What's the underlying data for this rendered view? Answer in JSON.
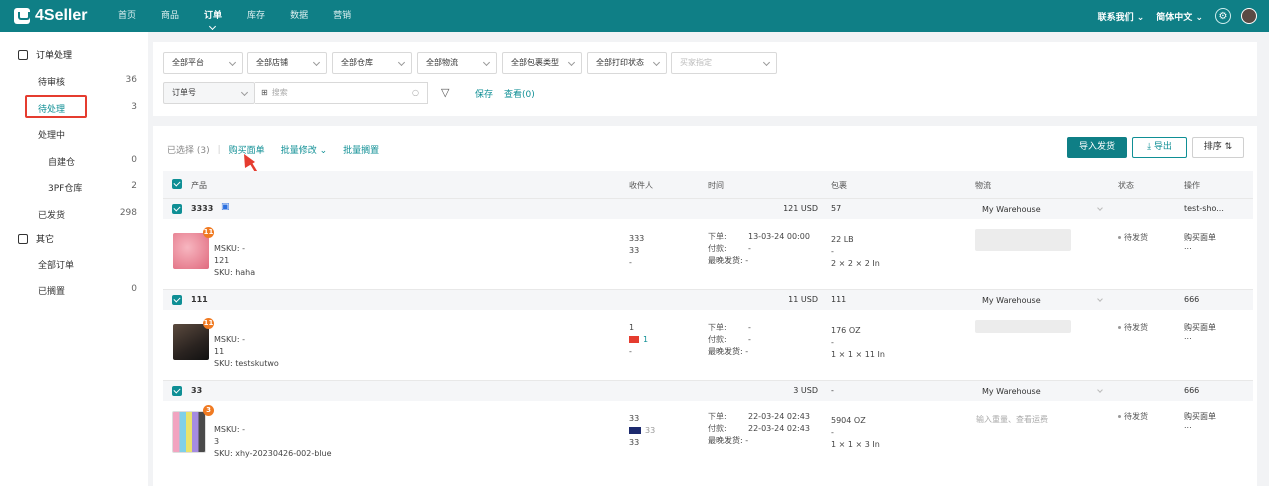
{
  "header": {
    "brand": "4Seller",
    "nav": [
      "首页",
      "商品",
      "订单",
      "库存",
      "数据",
      "营销"
    ],
    "active_nav": "订单",
    "contact": "联系我们",
    "language": "简体中文"
  },
  "sidebar": {
    "group1": "订单处理",
    "group2": "其它",
    "items": [
      {
        "label": "待审核",
        "count": "36"
      },
      {
        "label": "待处理",
        "count": "3"
      },
      {
        "label": "处理中",
        "count": ""
      },
      {
        "label": "自建仓",
        "count": "0"
      },
      {
        "label": "3PF仓库",
        "count": "2"
      },
      {
        "label": "已发货",
        "count": "298"
      },
      {
        "label": "全部订单",
        "count": ""
      },
      {
        "label": "已搁置",
        "count": "0"
      }
    ]
  },
  "filters": {
    "dropdowns": [
      "全部平台",
      "全部店铺",
      "全部仓库",
      "全部物流",
      "全部包裹类型",
      "全部打印状态",
      "买家指定"
    ],
    "order_no": "订单号",
    "search_placeholder": "搜索",
    "save": "保存",
    "view": "查看(0)"
  },
  "toolbar": {
    "selected": "已选择 (3)",
    "buy_label": "购买面单",
    "batch_edit": "批量修改",
    "batch_hold": "批量搁置",
    "import_ship": "导入发货",
    "export": "导出",
    "sort": "排序"
  },
  "table": {
    "headers": [
      "产品",
      "收件人",
      "时间",
      "包裹",
      "物流",
      "状态",
      "操作"
    ],
    "time_labels": [
      "下单:",
      "付款:",
      "最晚发货:"
    ],
    "orders": [
      {
        "group_id": "3333",
        "amount": "121 USD",
        "package_id": "57",
        "warehouse": "My Warehouse",
        "op_head": "test-sho...",
        "badge": "11",
        "msku": "MSKU: -",
        "qty": "121",
        "sku": "SKU: haha",
        "recipient": [
          "333",
          "33",
          "-"
        ],
        "order_time": "13-03-24 00:00",
        "pay_time": "-",
        "latest_ship": "-",
        "weight": "22 LB",
        "dash": "-",
        "dims": "2 × 2 × 2 In",
        "logistics_hint": "",
        "status": "待发货",
        "action": "购买面单",
        "more": "..."
      },
      {
        "group_id": "111",
        "amount": "11 USD",
        "package_id": "111",
        "warehouse": "My Warehouse",
        "op_head": "666",
        "badge": "11",
        "msku": "MSKU: -",
        "qty": "11",
        "sku": "SKU: testskutwo",
        "recipient": [
          "1",
          "1",
          "-"
        ],
        "order_time": "-",
        "pay_time": "-",
        "latest_ship": "-",
        "weight": "176 OZ",
        "dash": "-",
        "dims": "1 × 1 × 11 In",
        "logistics_hint": "",
        "status": "待发货",
        "action": "购买面单",
        "more": "..."
      },
      {
        "group_id": "33",
        "amount": "3 USD",
        "package_id": "-",
        "warehouse": "My Warehouse",
        "op_head": "666",
        "badge": "3",
        "msku": "MSKU: -",
        "qty": "3",
        "sku": "SKU: xhy-20230426-002-blue",
        "recipient": [
          "33",
          "33",
          "33"
        ],
        "order_time": "22-03-24 02:43",
        "pay_time": "22-03-24 02:43",
        "latest_ship": "-",
        "weight": "5904 OZ",
        "dash": "-",
        "dims": "1 × 1 × 3 In",
        "logistics_hint": "输入重量、查看运费",
        "status": "待发货",
        "action": "购买面单",
        "more": "..."
      }
    ]
  },
  "colors": {
    "brand": "#0f7f86",
    "link": "#0f8f95",
    "highlight": "#e53c2f",
    "badge": "#f07a22"
  }
}
